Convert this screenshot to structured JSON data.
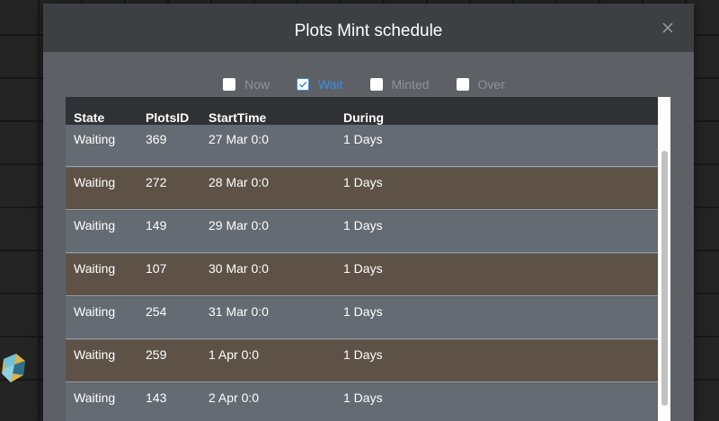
{
  "modal": {
    "title": "Plots Mint schedule",
    "close_icon": "close-icon"
  },
  "filters": [
    {
      "label": "Now",
      "checked": false
    },
    {
      "label": "Wait",
      "checked": true
    },
    {
      "label": "Minted",
      "checked": false
    },
    {
      "label": "Over",
      "checked": false
    }
  ],
  "colors": {
    "accent": "#3a8ee6",
    "row_odd": "#656b72",
    "row_even": "#5e5247",
    "header": "#2f3134"
  },
  "table": {
    "columns": [
      "State",
      "PlotsID",
      "StartTime",
      "During"
    ],
    "rows": [
      {
        "state": "Waiting",
        "id": "369",
        "start": "27 Mar 0:0",
        "during": "1 Days"
      },
      {
        "state": "Waiting",
        "id": "272",
        "start": "28 Mar 0:0",
        "during": "1 Days"
      },
      {
        "state": "Waiting",
        "id": "149",
        "start": "29 Mar 0:0",
        "during": "1 Days"
      },
      {
        "state": "Waiting",
        "id": "107",
        "start": "30 Mar 0:0",
        "during": "1 Days"
      },
      {
        "state": "Waiting",
        "id": "254",
        "start": "31 Mar 0:0",
        "during": "1 Days"
      },
      {
        "state": "Waiting",
        "id": "259",
        "start": "1 Apr 0:0",
        "during": "1 Days"
      },
      {
        "state": "Waiting",
        "id": "143",
        "start": "2 Apr 0:0",
        "during": "1 Days"
      }
    ]
  }
}
